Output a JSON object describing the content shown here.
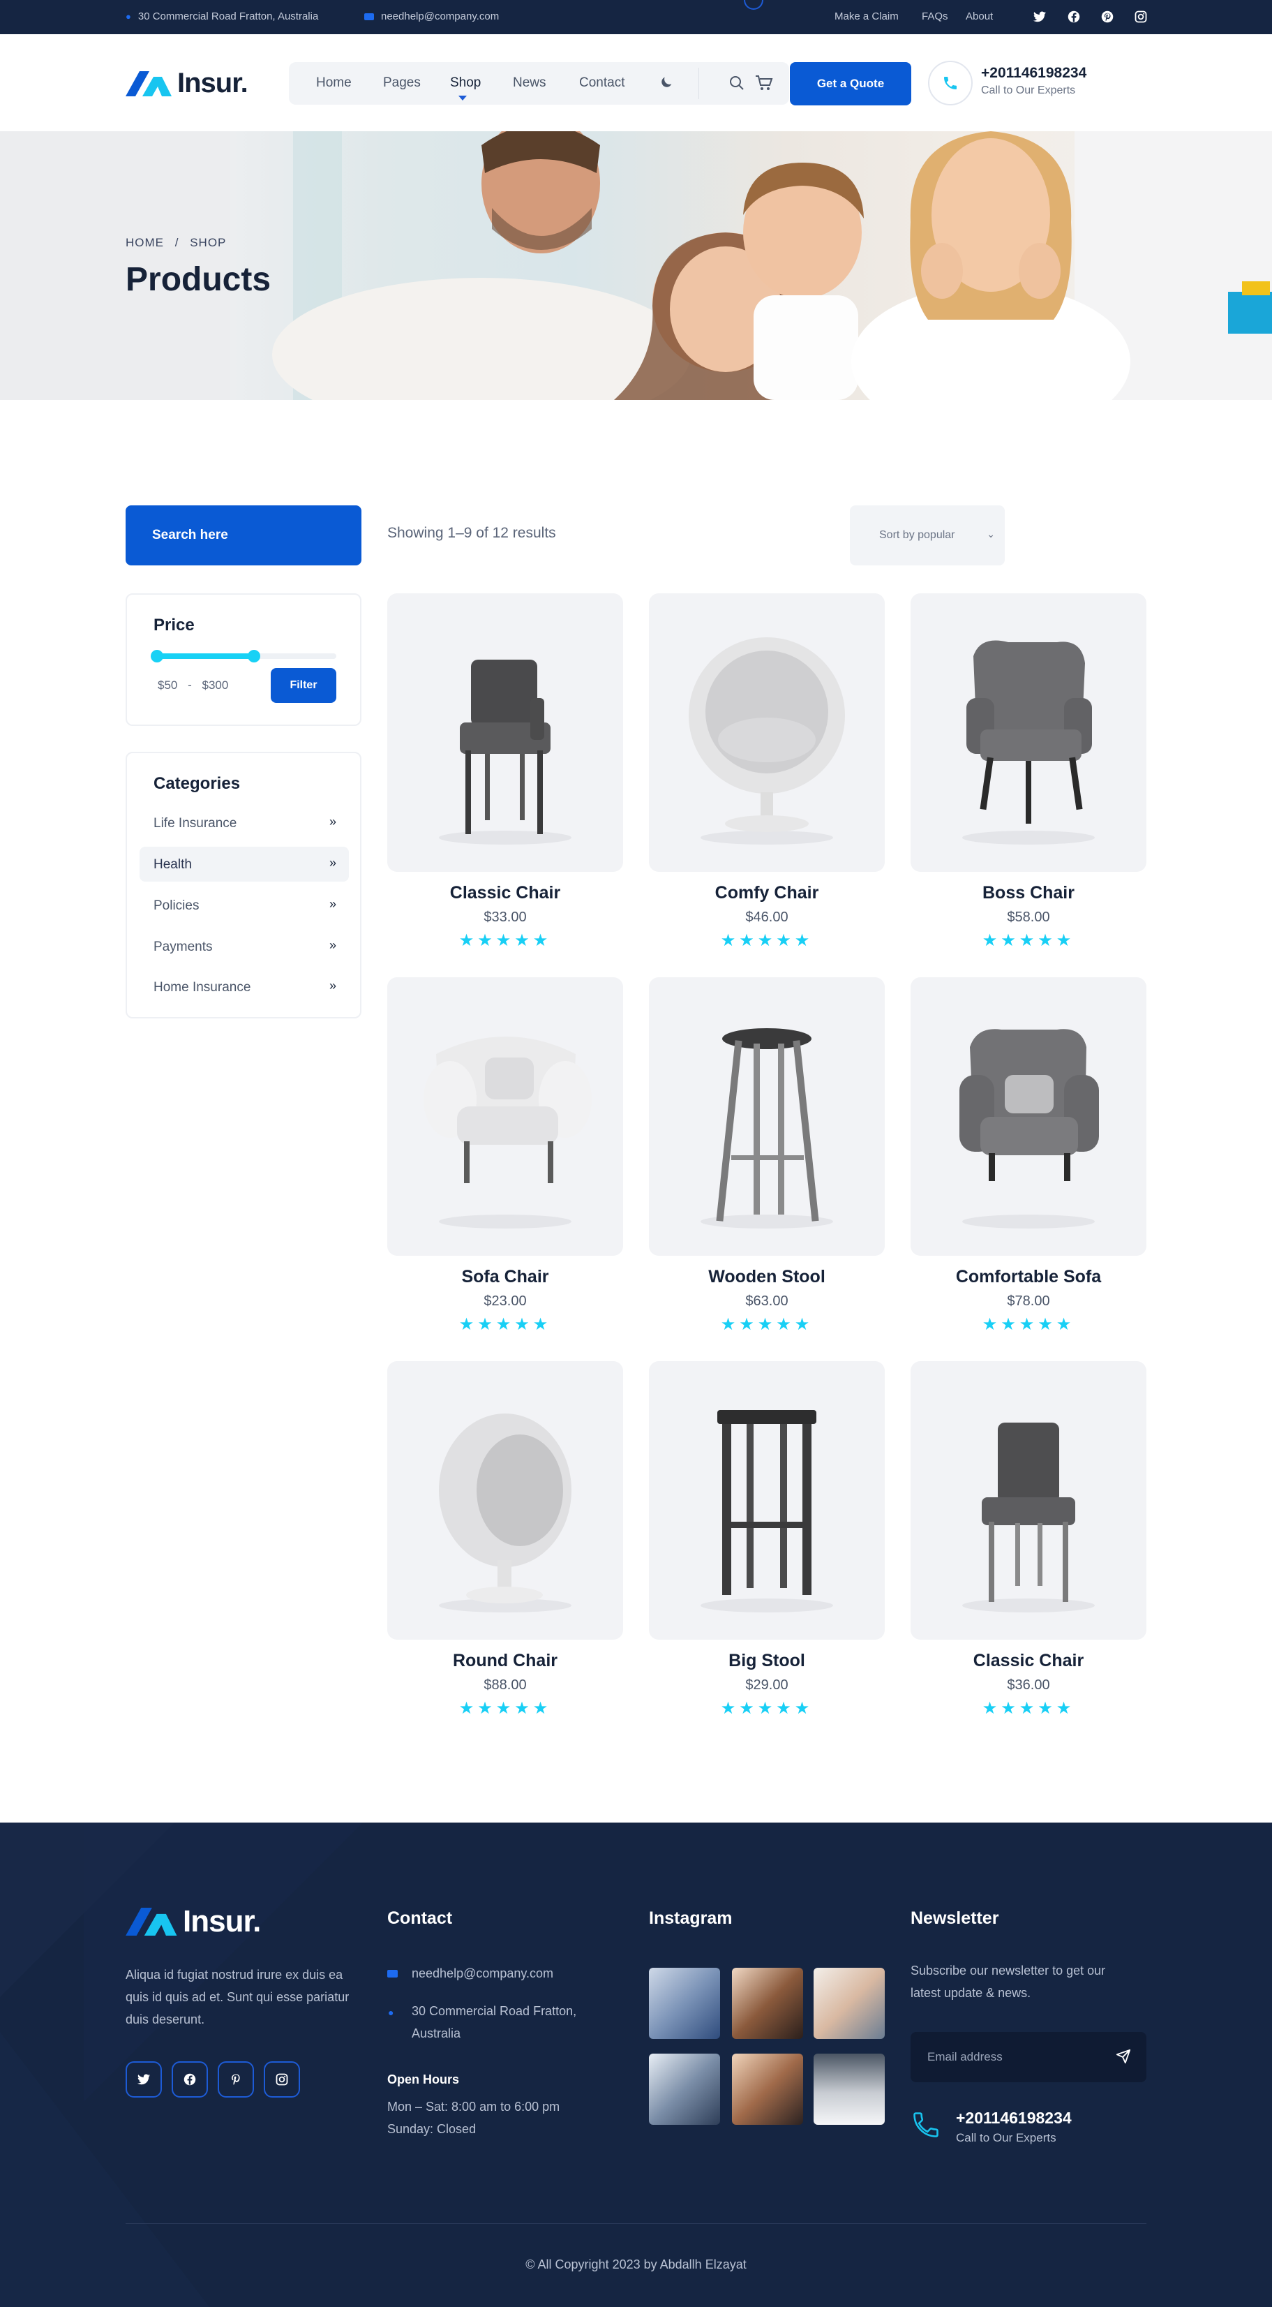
{
  "topbar": {
    "address": "30 Commercial Road Fratton, Australia",
    "email": "needhelp@company.com",
    "links": [
      "Make a Claim",
      "FAQs",
      "About"
    ],
    "social": [
      "twitter-icon",
      "facebook-icon",
      "pinterest-icon",
      "instagram-icon"
    ]
  },
  "header": {
    "logo": "Insur.",
    "nav": [
      "Home",
      "Pages",
      "Shop",
      "News",
      "Contact"
    ],
    "active_nav": "Shop",
    "quote_button": "Get a Quote",
    "phone": "+201146198234",
    "phone_caption": "Call to Our Experts"
  },
  "hero": {
    "breadcrumb_home": "HOME",
    "breadcrumb_sep": "/",
    "breadcrumb_current": "SHOP",
    "title": "Products"
  },
  "sidebar": {
    "search_label": "Search here",
    "price": {
      "title": "Price",
      "range_min": "$50",
      "range_sep": "-",
      "range_max": "$300",
      "filter_button": "Filter",
      "fill_fraction": 0.55
    },
    "categories": {
      "title": "Categories",
      "items": [
        "Life Insurance",
        "Health",
        "Policies",
        "Payments",
        "Home Insurance"
      ],
      "highlighted": "Health"
    }
  },
  "toolbar": {
    "results_text": "Showing 1–9 of 12 results",
    "sort_label": "Sort by popular"
  },
  "products": [
    {
      "name": "Classic Chair",
      "price": "$33.00",
      "rating": 5,
      "kind": "dining-chair"
    },
    {
      "name": "Comfy Chair",
      "price": "$46.00",
      "rating": 5,
      "kind": "egg-chair"
    },
    {
      "name": "Boss Chair",
      "price": "$58.00",
      "rating": 5,
      "kind": "wingback-chair"
    },
    {
      "name": "Sofa Chair",
      "price": "$23.00",
      "rating": 5,
      "kind": "white-armchair"
    },
    {
      "name": "Wooden Stool",
      "price": "$63.00",
      "rating": 5,
      "kind": "bar-stool"
    },
    {
      "name": "Comfortable Sofa",
      "price": "$78.00",
      "rating": 5,
      "kind": "grey-armchair"
    },
    {
      "name": "Round Chair",
      "price": "$88.00",
      "rating": 5,
      "kind": "ball-chair"
    },
    {
      "name": "Big Stool",
      "price": "$29.00",
      "rating": 5,
      "kind": "square-stool"
    },
    {
      "name": "Classic Chair",
      "price": "$36.00",
      "rating": 5,
      "kind": "side-chair"
    }
  ],
  "footer": {
    "logo": "Insur.",
    "about": "Aliqua id fugiat nostrud irure ex duis ea quis id quis ad et. Sunt qui esse pariatur duis deserunt.",
    "contact": {
      "title": "Contact",
      "email": "needhelp@company.com",
      "address": "30 Commercial Road Fratton, Australia",
      "hours_title": "Open Hours",
      "hours_weekday": "Mon – Sat: 8:00 am to 6:00 pm",
      "hours_sunday": "Sunday: Closed"
    },
    "instagram_title": "Instagram",
    "newsletter": {
      "title": "Newsletter",
      "text": "Subscribe our newsletter to get our latest update & news.",
      "placeholder": "Email address",
      "phone": "+201146198234",
      "phone_caption": "Call to Our Experts"
    },
    "copyright": "© All Copyright 2023 by Abdallh Elzayat"
  },
  "colors": {
    "navy": "#152542",
    "brand_blue": "#0a5ad4",
    "accent_cyan": "#18d1f5"
  }
}
